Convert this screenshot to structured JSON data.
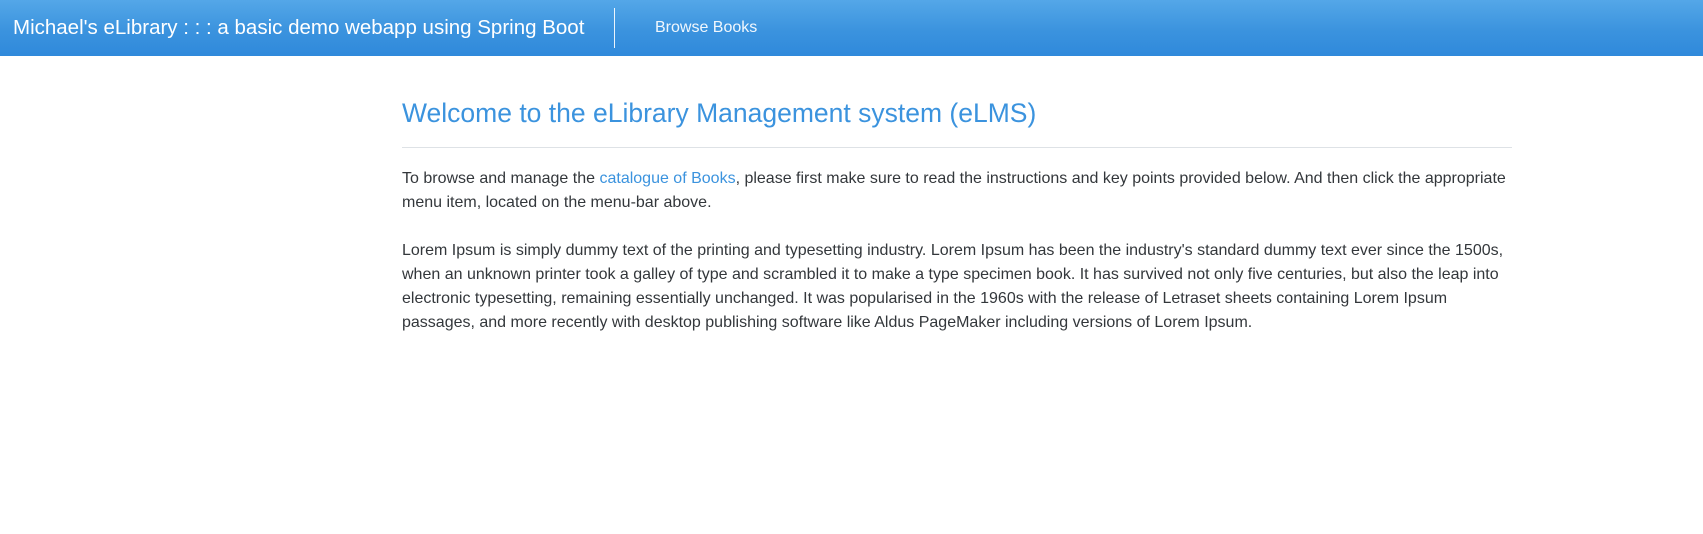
{
  "navbar": {
    "brand": "Michael's eLibrary : : : a basic demo webapp using Spring Boot",
    "links": [
      {
        "label": "Browse Books"
      }
    ]
  },
  "main": {
    "title": "Welcome to the eLibrary Management system (eLMS)",
    "intro": {
      "before_link": "To browse and manage the ",
      "link_text": "catalogue of Books",
      "after_link": ", please first make sure to read the instructions and key points provided below. And then click the appropriate menu item, located on the menu-bar above."
    },
    "lorem": "Lorem Ipsum is simply dummy text of the printing and typesetting industry. Lorem Ipsum has been the industry's standard dummy text ever since the 1500s, when an unknown printer took a galley of type and scrambled it to make a type specimen book. It has survived not only five centuries, but also the leap into electronic typesetting, remaining essentially unchanged. It was popularised in the 1960s with the release of Letraset sheets containing Lorem Ipsum passages, and more recently with desktop publishing software like Aldus PageMaker including versions of Lorem Ipsum."
  },
  "colors": {
    "navbar_top": "#54a7e8",
    "navbar_bottom": "#2f89db",
    "accent": "#3b93de",
    "body_text": "#33373b",
    "rule": "#dee2e6"
  }
}
